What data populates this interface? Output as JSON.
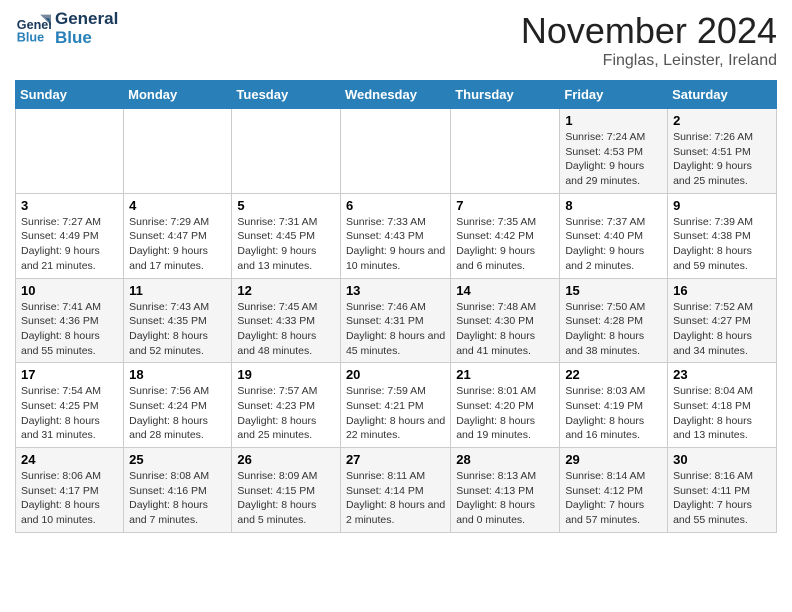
{
  "logo": {
    "line1": "General",
    "line2": "Blue"
  },
  "title": "November 2024",
  "location": "Finglas, Leinster, Ireland",
  "days_of_week": [
    "Sunday",
    "Monday",
    "Tuesday",
    "Wednesday",
    "Thursday",
    "Friday",
    "Saturday"
  ],
  "weeks": [
    [
      {
        "day": "",
        "info": ""
      },
      {
        "day": "",
        "info": ""
      },
      {
        "day": "",
        "info": ""
      },
      {
        "day": "",
        "info": ""
      },
      {
        "day": "",
        "info": ""
      },
      {
        "day": "1",
        "info": "Sunrise: 7:24 AM\nSunset: 4:53 PM\nDaylight: 9 hours and 29 minutes."
      },
      {
        "day": "2",
        "info": "Sunrise: 7:26 AM\nSunset: 4:51 PM\nDaylight: 9 hours and 25 minutes."
      }
    ],
    [
      {
        "day": "3",
        "info": "Sunrise: 7:27 AM\nSunset: 4:49 PM\nDaylight: 9 hours and 21 minutes."
      },
      {
        "day": "4",
        "info": "Sunrise: 7:29 AM\nSunset: 4:47 PM\nDaylight: 9 hours and 17 minutes."
      },
      {
        "day": "5",
        "info": "Sunrise: 7:31 AM\nSunset: 4:45 PM\nDaylight: 9 hours and 13 minutes."
      },
      {
        "day": "6",
        "info": "Sunrise: 7:33 AM\nSunset: 4:43 PM\nDaylight: 9 hours and 10 minutes."
      },
      {
        "day": "7",
        "info": "Sunrise: 7:35 AM\nSunset: 4:42 PM\nDaylight: 9 hours and 6 minutes."
      },
      {
        "day": "8",
        "info": "Sunrise: 7:37 AM\nSunset: 4:40 PM\nDaylight: 9 hours and 2 minutes."
      },
      {
        "day": "9",
        "info": "Sunrise: 7:39 AM\nSunset: 4:38 PM\nDaylight: 8 hours and 59 minutes."
      }
    ],
    [
      {
        "day": "10",
        "info": "Sunrise: 7:41 AM\nSunset: 4:36 PM\nDaylight: 8 hours and 55 minutes."
      },
      {
        "day": "11",
        "info": "Sunrise: 7:43 AM\nSunset: 4:35 PM\nDaylight: 8 hours and 52 minutes."
      },
      {
        "day": "12",
        "info": "Sunrise: 7:45 AM\nSunset: 4:33 PM\nDaylight: 8 hours and 48 minutes."
      },
      {
        "day": "13",
        "info": "Sunrise: 7:46 AM\nSunset: 4:31 PM\nDaylight: 8 hours and 45 minutes."
      },
      {
        "day": "14",
        "info": "Sunrise: 7:48 AM\nSunset: 4:30 PM\nDaylight: 8 hours and 41 minutes."
      },
      {
        "day": "15",
        "info": "Sunrise: 7:50 AM\nSunset: 4:28 PM\nDaylight: 8 hours and 38 minutes."
      },
      {
        "day": "16",
        "info": "Sunrise: 7:52 AM\nSunset: 4:27 PM\nDaylight: 8 hours and 34 minutes."
      }
    ],
    [
      {
        "day": "17",
        "info": "Sunrise: 7:54 AM\nSunset: 4:25 PM\nDaylight: 8 hours and 31 minutes."
      },
      {
        "day": "18",
        "info": "Sunrise: 7:56 AM\nSunset: 4:24 PM\nDaylight: 8 hours and 28 minutes."
      },
      {
        "day": "19",
        "info": "Sunrise: 7:57 AM\nSunset: 4:23 PM\nDaylight: 8 hours and 25 minutes."
      },
      {
        "day": "20",
        "info": "Sunrise: 7:59 AM\nSunset: 4:21 PM\nDaylight: 8 hours and 22 minutes."
      },
      {
        "day": "21",
        "info": "Sunrise: 8:01 AM\nSunset: 4:20 PM\nDaylight: 8 hours and 19 minutes."
      },
      {
        "day": "22",
        "info": "Sunrise: 8:03 AM\nSunset: 4:19 PM\nDaylight: 8 hours and 16 minutes."
      },
      {
        "day": "23",
        "info": "Sunrise: 8:04 AM\nSunset: 4:18 PM\nDaylight: 8 hours and 13 minutes."
      }
    ],
    [
      {
        "day": "24",
        "info": "Sunrise: 8:06 AM\nSunset: 4:17 PM\nDaylight: 8 hours and 10 minutes."
      },
      {
        "day": "25",
        "info": "Sunrise: 8:08 AM\nSunset: 4:16 PM\nDaylight: 8 hours and 7 minutes."
      },
      {
        "day": "26",
        "info": "Sunrise: 8:09 AM\nSunset: 4:15 PM\nDaylight: 8 hours and 5 minutes."
      },
      {
        "day": "27",
        "info": "Sunrise: 8:11 AM\nSunset: 4:14 PM\nDaylight: 8 hours and 2 minutes."
      },
      {
        "day": "28",
        "info": "Sunrise: 8:13 AM\nSunset: 4:13 PM\nDaylight: 8 hours and 0 minutes."
      },
      {
        "day": "29",
        "info": "Sunrise: 8:14 AM\nSunset: 4:12 PM\nDaylight: 7 hours and 57 minutes."
      },
      {
        "day": "30",
        "info": "Sunrise: 8:16 AM\nSunset: 4:11 PM\nDaylight: 7 hours and 55 minutes."
      }
    ]
  ]
}
